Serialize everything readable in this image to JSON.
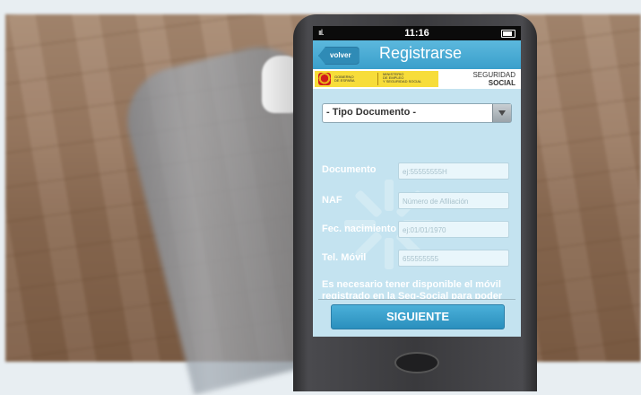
{
  "status_bar": {
    "signal": "ııl.",
    "time": "11:16"
  },
  "header": {
    "back_label": "volver",
    "title": "Registrarse"
  },
  "logos": {
    "gov_left": "GOBIERNO\nDE ESPAÑA",
    "gov_right": "MINISTERIO\nDE EMPLEO\nY SEGURIDAD SOCIAL",
    "seguridad": "SEGURIDAD",
    "social": "SOCIAL"
  },
  "form": {
    "document_type": {
      "selected": "- Tipo Documento -"
    },
    "fields": [
      {
        "label": "Documento",
        "placeholder": "ej:55555555H"
      },
      {
        "label": "NAF",
        "placeholder": "Número de Afiliación"
      },
      {
        "label": "Fec. nacimiento",
        "placeholder": "ej:01/01/1970"
      },
      {
        "label": "Tel. Móvil",
        "placeholder": "655555555"
      }
    ],
    "note": "Es necesario tener disponible el móvil registrado en la Seg-Social para poder completar el registro"
  },
  "actions": {
    "next_label": "SIGUIENTE"
  },
  "colors": {
    "accent": "#3a9fcb",
    "gov_yellow": "#f7dd3a",
    "background": "#c4e3f0"
  }
}
